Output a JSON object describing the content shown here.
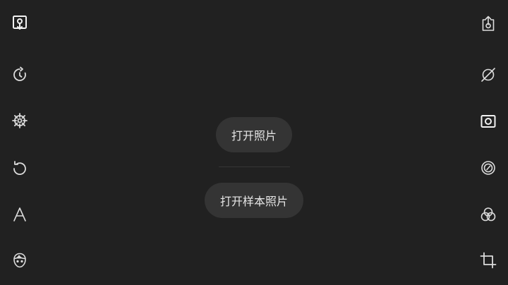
{
  "main": {
    "open_photo_label": "打开照片",
    "open_sample_label": "打开样本照片"
  },
  "left_toolbar": {
    "icons": [
      "save-photo-icon",
      "auto-adjust-icon",
      "wheel-icon",
      "rotate-icon",
      "text-icon",
      "face-icon"
    ]
  },
  "right_toolbar": {
    "icons": [
      "share-icon",
      "disable-icon",
      "camera-frame-icon",
      "vignette-icon",
      "color-balance-icon",
      "crop-icon"
    ]
  },
  "colors": {
    "background": "#212121",
    "pill": "#343434",
    "icon": "#dcdcdc",
    "text": "#e6e6e6"
  }
}
